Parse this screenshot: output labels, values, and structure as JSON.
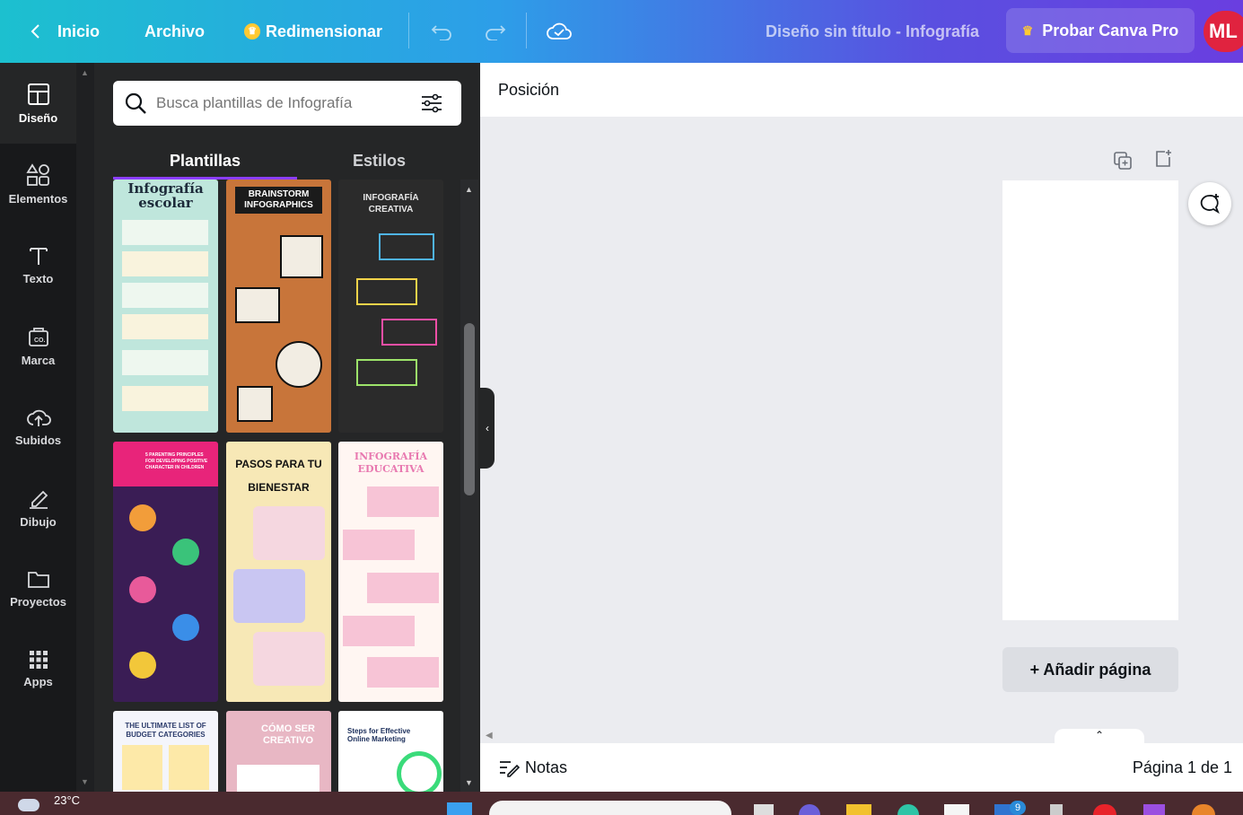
{
  "topbar": {
    "back_label": "Inicio",
    "file_label": "Archivo",
    "resize_label": "Redimensionar",
    "doc_title": "Diseño sin título - Infografía",
    "pro_label": "Probar Canva Pro",
    "avatar_initials": "ML"
  },
  "rail": [
    {
      "label": "Diseño",
      "icon": "layout-icon"
    },
    {
      "label": "Elementos",
      "icon": "shapes-icon"
    },
    {
      "label": "Texto",
      "icon": "text-icon"
    },
    {
      "label": "Marca",
      "icon": "brand-icon"
    },
    {
      "label": "Subidos",
      "icon": "upload-cloud-icon"
    },
    {
      "label": "Dibujo",
      "icon": "draw-icon"
    },
    {
      "label": "Proyectos",
      "icon": "folder-icon"
    },
    {
      "label": "Apps",
      "icon": "apps-grid-icon"
    }
  ],
  "panel": {
    "search_placeholder": "Busca plantillas de Infografía",
    "tabs": [
      "Plantillas",
      "Estilos"
    ],
    "templates": [
      {
        "title": "Infografía escolar",
        "bg": "#bfe6dc"
      },
      {
        "title": "BRAINSTORM INFOGRAPHICS",
        "bg": "#c8753a"
      },
      {
        "title": "INFOGRAFÍA CREATIVA",
        "bg": "#2b2b2b"
      },
      {
        "title": "5 PARENTING PRINCIPLES FOR DEVELOPING POSITIVE CHARACTER IN CHILDREN",
        "bg": "#3a1d55"
      },
      {
        "title": "PASOS PARA TU BIENESTAR",
        "bg": "#f7e8b6"
      },
      {
        "title": "INFOGRAFÍA EDUCATIVA",
        "bg": "#fff6f2"
      },
      {
        "title": "THE ULTIMATE LIST OF BUDGET CATEGORIES",
        "bg": "#f4f5fb"
      },
      {
        "title": "CÓMO SER CREATIVO",
        "bg": "#e8b7c4"
      },
      {
        "title": "Steps for Effective Online Marketing",
        "bg": "#ffffff"
      }
    ]
  },
  "canvas": {
    "position_label": "Posición",
    "add_page_label": "+ Añadir página",
    "notes_label": "Notas",
    "page_indicator": "Página 1 de 1"
  },
  "taskbar": {
    "temperature": "23°C",
    "badge_count": "9"
  }
}
